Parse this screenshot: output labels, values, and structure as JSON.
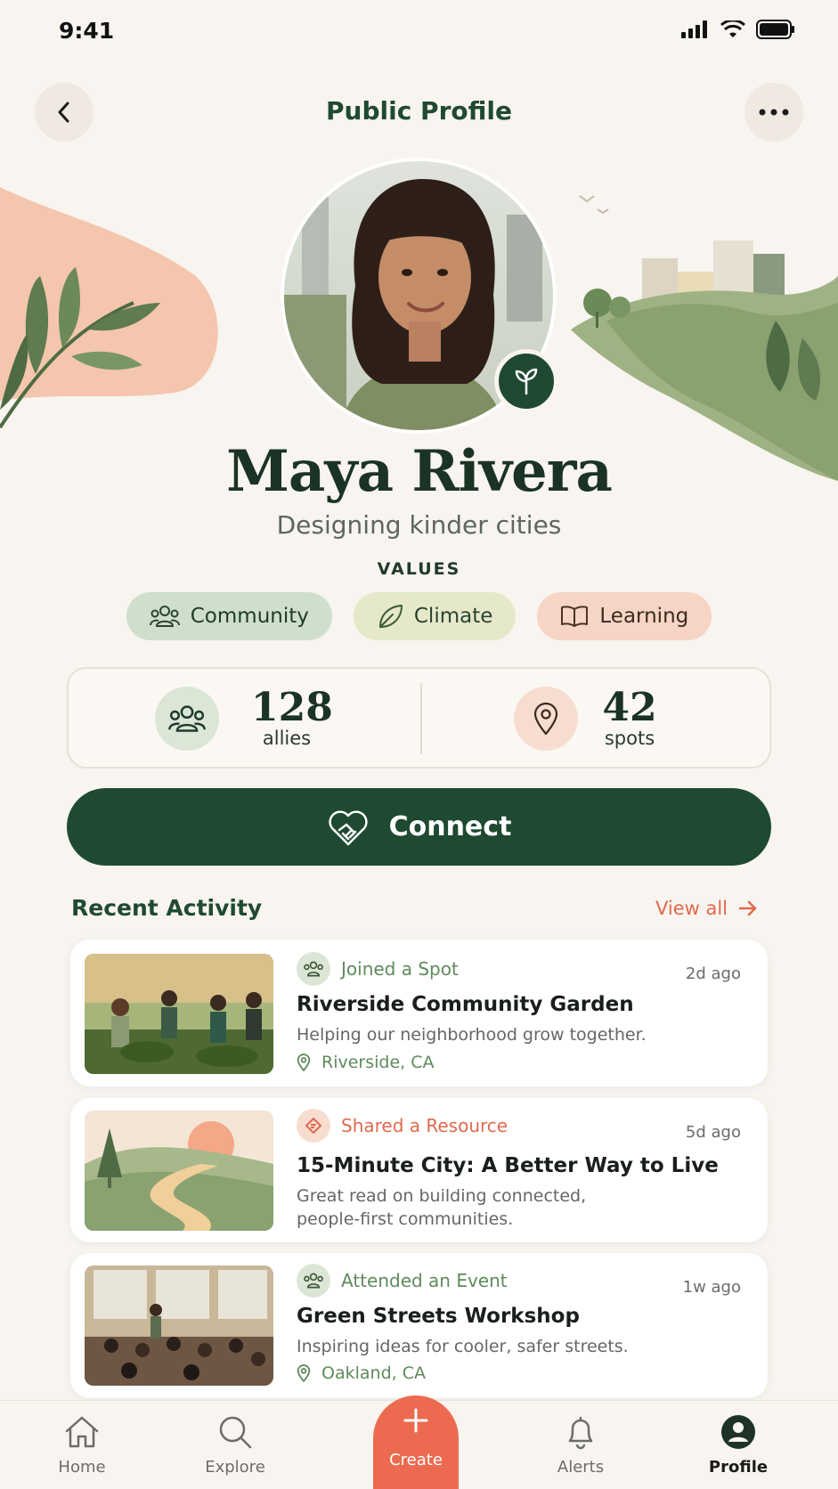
{
  "status_bar": {
    "time": "9:41"
  },
  "header": {
    "title": "Public Profile"
  },
  "profile": {
    "name": "Maya Rivera",
    "tagline": "Designing kinder cities",
    "values_label": "VALUES",
    "values": [
      {
        "label": "Community",
        "icon": "people-icon"
      },
      {
        "label": "Climate",
        "icon": "leaf-icon"
      },
      {
        "label": "Learning",
        "icon": "book-icon"
      }
    ]
  },
  "stats": {
    "allies": {
      "value": "128",
      "label": "allies",
      "icon": "people-icon"
    },
    "spots": {
      "value": "42",
      "label": "spots",
      "icon": "location-pin-icon"
    }
  },
  "connect_label": "Connect",
  "recent": {
    "title": "Recent Activity",
    "view_all": "View all",
    "items": [
      {
        "type": "Joined a Spot",
        "time": "2d ago",
        "title": "Riverside Community Garden",
        "description": "Helping our neighborhood grow together.",
        "location": "Riverside, CA"
      },
      {
        "type": "Shared a Resource",
        "time": "5d ago",
        "title": "15-Minute City: A Better Way to Live",
        "description": "Great read on building connected, people-first communities."
      },
      {
        "type": "Attended an Event",
        "time": "1w ago",
        "title": "Green Streets Workshop",
        "description": "Inspiring ideas for cooler, safer streets.",
        "location": "Oakland, CA"
      }
    ]
  },
  "tabbar": {
    "home": "Home",
    "explore": "Explore",
    "create": "Create",
    "alerts": "Alerts",
    "profile": "Profile"
  },
  "colors": {
    "primary": "#1e4a31",
    "accent": "#ec6b50",
    "background": "#f8f4ef"
  }
}
